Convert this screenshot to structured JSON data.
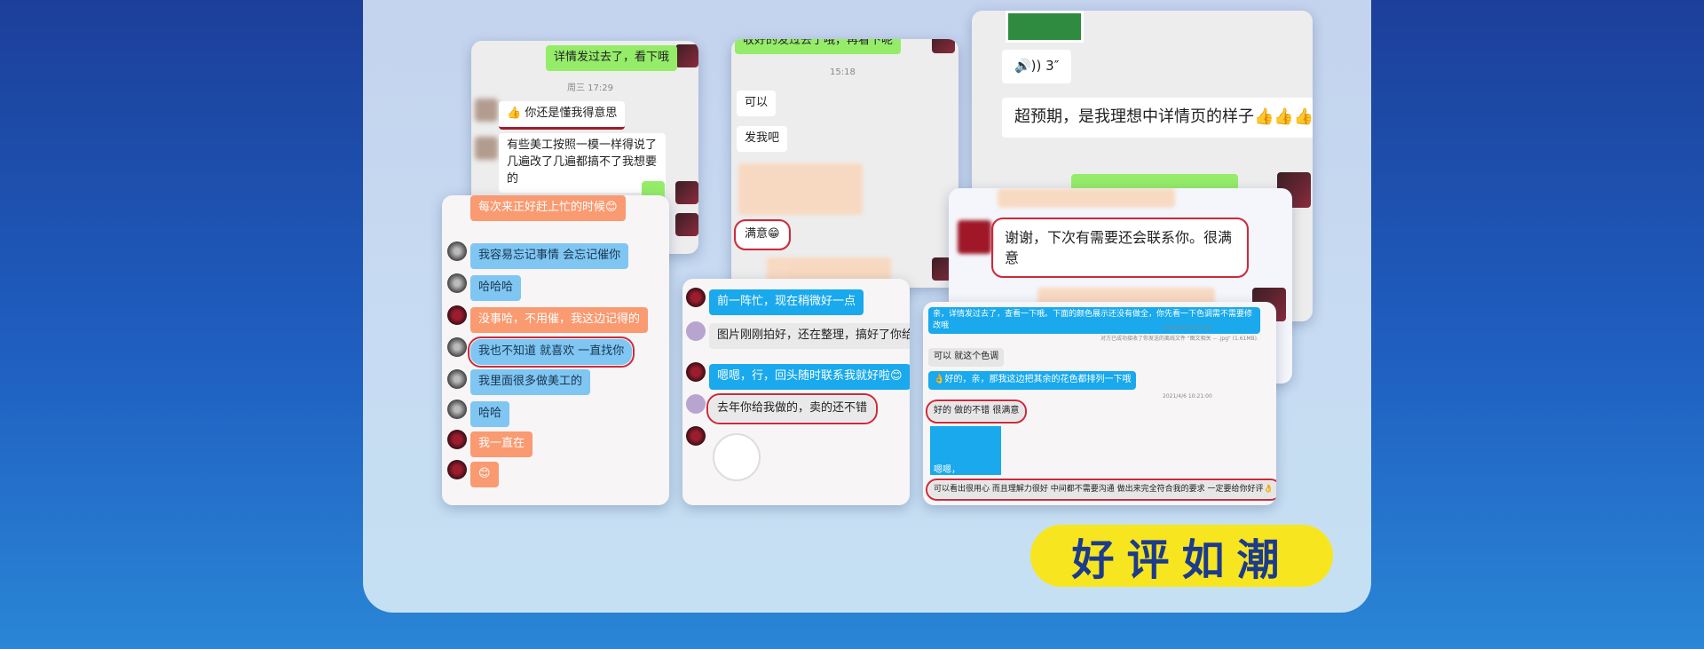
{
  "banner": {
    "label": "好评如潮"
  },
  "chat1": {
    "bubble_sent": "详情发过去了，看下哦",
    "timestamp": "周三 17:29",
    "bubble_1": "👍 你还是懂我得意思",
    "bubble_2": "有些美工按照一模一样得说了几遍改了几遍都搞不了我想要的"
  },
  "chat2": {
    "top_partial": "收好的发过去了哦，再看下呢",
    "timestamp": "15:18",
    "bubble_1": "可以",
    "bubble_2": "发我吧",
    "bubble_3": "满意😁"
  },
  "chat3": {
    "voice": "🔊)) 3″",
    "bubble_1": "超预期，是我理想中详情页的样子👍👍👍"
  },
  "chat4": {
    "bubble_top": "每次来正好赶上忙的时候😊",
    "bubble_1": "我容易忘记事情  会忘记催你",
    "bubble_2": "哈哈哈",
    "bubble_3": "没事哈，不用催，我这边记得的",
    "bubble_4": "我也不知道  就喜欢  一直找你",
    "bubble_5": "我里面很多做美工的",
    "bubble_6": "哈哈",
    "bubble_7": "我一直在",
    "bubble_8": "😊"
  },
  "chat5": {
    "bubble_1": "前一阵忙，现在稍微好一点",
    "bubble_2": "图片刚刚拍好，还在整理，搞好了你给我做",
    "bubble_3": "嗯嗯，行，回头随时联系我就好啦😊",
    "bubble_4": "去年你给我做的，卖的还不错"
  },
  "chat6": {
    "bubble_1": "谢谢，下次有需要还会联系你。很满意"
  },
  "chat7": {
    "bubble_1": "亲，详情发过去了，查看一下哦。下面的颜色展示还没有做全，你先看一下色调需不需要修改哦",
    "ts_1": "2021/4/6 10:17:01",
    "file_note": "对方已成功接收了你发送的离线文件 \"图文相关 -- .jpg\" (1.61MB).",
    "bubble_2": "可以 就这个色调",
    "bubble_3": "👌好的，亲，那我这边把其余的花色都排列一下哦",
    "ts_2": "2021/4/6 10:21:00",
    "bubble_4": "好的 做的不错 很满意",
    "bubble_5": "嗯嗯，",
    "bubble_6": "可以看出很用心 而且理解力很好 中间都不需要沟通 做出来完全符合我的要求 一定要给你好评👌"
  }
}
